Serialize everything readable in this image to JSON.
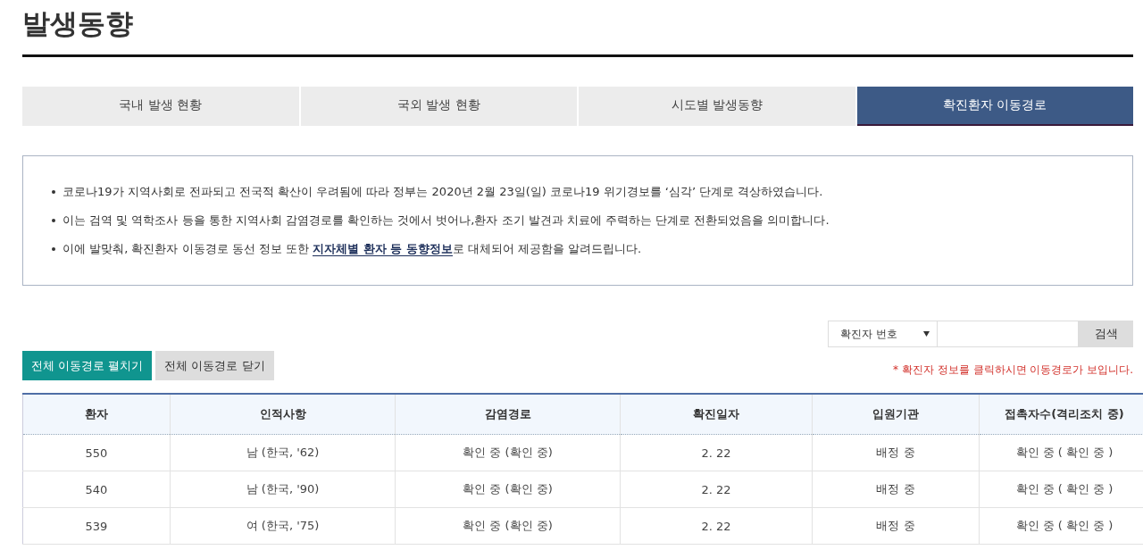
{
  "page_title": "발생동향",
  "tabs": [
    {
      "label": "국내 발생 현황",
      "selected": false
    },
    {
      "label": "국외 발생 현황",
      "selected": false
    },
    {
      "label": "시도별 발생동향",
      "selected": false
    },
    {
      "label": "확진환자 이동경로",
      "selected": true
    }
  ],
  "notice": [
    {
      "text": "코로나19가 지역사회로 전파되고 전국적 확산이 우려됨에 따라 정부는 2020년 2월 23일(일) 코로나19 위기경보를 ‘심각’ 단계로 격상하였습니다."
    },
    {
      "text": "이는 검역 및 역학조사 등을 통한 지역사회 감염경로를 확인하는 것에서 벗어나,환자 조기 발견과 치료에 주력하는 단계로 전환되었음을 의미합니다."
    },
    {
      "text": "이에 발맞춰, 확진환자 이동경로 동선 정보 또한 ",
      "link": "지자체별 환자 등 동향정보",
      "after": "로 대체되어 제공함을 알려드립니다."
    }
  ],
  "search": {
    "filter": "확진자 번호",
    "button": "검색"
  },
  "buttons": [
    {
      "label": "전체 이동경로 펼치기",
      "kind": "primary"
    },
    {
      "label": "전체 이동경로 닫기",
      "kind": "secondary"
    }
  ],
  "hint": "* 확진자 정보를 클릭하시면 이동경로가 보입니다.",
  "table": {
    "columns": [
      "환자",
      "인적사항",
      "감염경로",
      "확진일자",
      "입원기관",
      "접촉자수(격리조치 중)"
    ],
    "rows": [
      [
        "550",
        "남 (한국, '62)",
        "확인 중 (확인 중)",
        "2. 22",
        "배정 중",
        "확인 중 ( 확인 중 )"
      ],
      [
        "540",
        "남 (한국, '90)",
        "확인 중 (확인 중)",
        "2. 22",
        "배정 중",
        "확인 중 ( 확인 중 )"
      ],
      [
        "539",
        "여 (한국, '75)",
        "확인 중 (확인 중)",
        "2. 22",
        "배정 중",
        "확인 중 ( 확인 중 )"
      ]
    ]
  }
}
